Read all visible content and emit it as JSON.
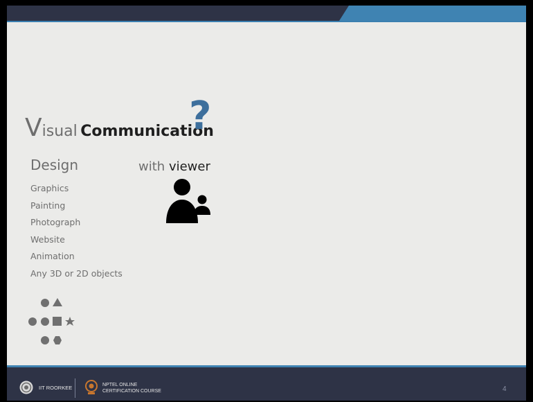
{
  "title": {
    "visual_initial": "V",
    "visual_rest": "isual",
    "communication": "Communication",
    "question_mark": "?"
  },
  "design": {
    "heading": "Design",
    "items": [
      "Graphics",
      "Painting",
      "Photograph",
      "Website",
      "Animation",
      "Any 3D or 2D objects"
    ]
  },
  "viewer": {
    "with": "with",
    "viewer": "viewer",
    "icon": "users-icon"
  },
  "shapes_icon": "shapes-icon",
  "footer": {
    "institute": "IIT ROORKEE",
    "course_line1": "NPTEL ONLINE",
    "course_line2": "CERTIFICATION COURSE",
    "page_number": "4"
  },
  "colors": {
    "dark_bar": "#2e3346",
    "accent_blue": "#3f83b2",
    "question_mark": "#3d6f9c",
    "slide_bg": "#ebebe9"
  }
}
